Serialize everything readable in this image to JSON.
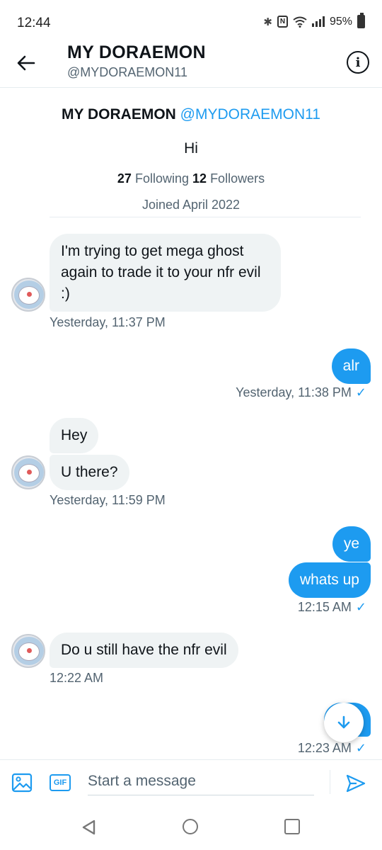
{
  "status_bar": {
    "time": "12:44",
    "battery": "95%"
  },
  "header": {
    "title": "MY DORAEMON",
    "handle": "@MYDORAEMON11"
  },
  "profile": {
    "name": "MY DORAEMON",
    "handle": "@MYDORAEMON11",
    "bio": "Hi",
    "following_count": "27",
    "following_label": "Following",
    "followers_count": "12",
    "followers_label": "Followers",
    "joined": "Joined April 2022"
  },
  "messages": [
    {
      "dir": "in",
      "text": "I'm trying to get mega ghost again to trade it to your nfr evil :)"
    },
    {
      "dir": "in",
      "time": "Yesterday, 11:37 PM"
    },
    {
      "dir": "out",
      "text": "alr",
      "time": "Yesterday, 11:38 PM"
    },
    {
      "dir": "in",
      "text": "Hey"
    },
    {
      "dir": "in",
      "text": "U there?",
      "time": "Yesterday, 11:59 PM"
    },
    {
      "dir": "out",
      "text": "ye"
    },
    {
      "dir": "out",
      "text": "whats up",
      "time": "12:15 AM"
    },
    {
      "dir": "in",
      "text": "Do u still have the nfr evil",
      "time": "12:22 AM"
    },
    {
      "dir": "out",
      "time": "12:23 AM"
    }
  ],
  "checkmark": "✓",
  "composer": {
    "gif_label": "GIF",
    "placeholder": "Start a message"
  },
  "colors": {
    "accent": "#1d9bf0",
    "incoming_bubble": "#eff3f4",
    "text": "#0f1419",
    "muted": "#536471"
  },
  "icons": [
    "back-arrow-icon",
    "info-icon",
    "image-icon",
    "gif-icon",
    "send-icon",
    "arrow-down-icon",
    "nav-back-icon",
    "nav-home-icon",
    "nav-recents-icon"
  ]
}
